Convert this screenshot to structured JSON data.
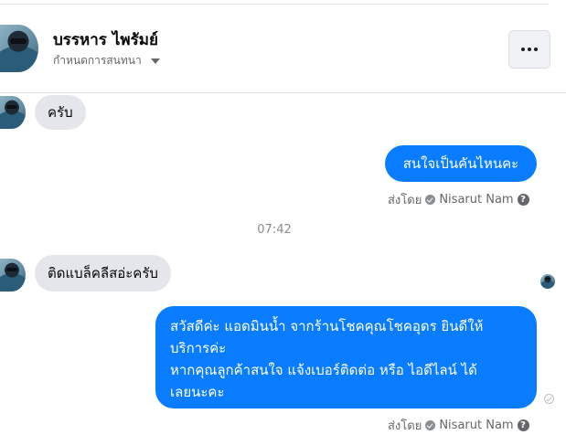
{
  "header": {
    "contact_name": "บรรหาร ไพรัมย์",
    "conversation_settings": "กำหนดการสนทนา",
    "more_options_icon": "ellipsis-icon"
  },
  "messages": [
    {
      "direction": "incoming",
      "text": "ครับ"
    },
    {
      "direction": "outgoing",
      "text": "สนใจเป็นคันไหนคะ",
      "sent_by_label": "ส่งโดย",
      "sent_by_name": "Nisarut Nam"
    },
    {
      "direction": "incoming",
      "text": "ติดแบล็คลีสอ่ะครับ"
    },
    {
      "direction": "outgoing",
      "lines": [
        "สวัสดีค่ะ แอดมินน้ำ จากร้านโชคคุณโชคอุดร ยินดีให้",
        "บริการค่ะ",
        "หากคุณลูกค้าสนใจ แจ้งเบอร์ติดต่อ หรือ ไอดีไลน์ ได้",
        "เลยนะคะ"
      ],
      "sent_by_label": "ส่งโดย",
      "sent_by_name": "Nisarut Nam"
    }
  ],
  "timestamp": "07:42",
  "help_glyph": "?",
  "colors": {
    "outgoing_bubble": "#0a7cff",
    "incoming_bubble": "#e4e6eb",
    "meta_text": "#65676b"
  }
}
